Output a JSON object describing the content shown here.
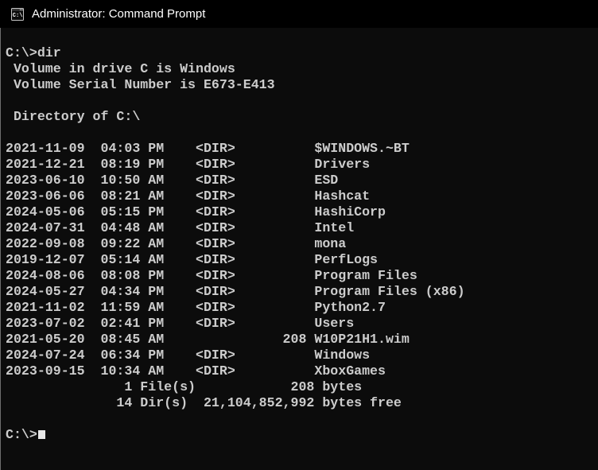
{
  "window": {
    "title": "Administrator: Command Prompt"
  },
  "colors": {
    "titlebar_background": "#000000",
    "titlebar_text": "#FFFFFF",
    "console_background": "#0C0C0C",
    "console_text": "#CCCCCC",
    "cursor": "#E8E8E8",
    "window_border": "#6E6E6E"
  },
  "terminal": {
    "lines": [
      "C:\\>dir",
      " Volume in drive C is Windows",
      " Volume Serial Number is E673-E413",
      "",
      " Directory of C:\\",
      "",
      "2021-11-09  04:03 PM    <DIR>          $WINDOWS.~BT",
      "2021-12-21  08:19 PM    <DIR>          Drivers",
      "2023-06-10  10:50 AM    <DIR>          ESD",
      "2023-06-06  08:21 AM    <DIR>          Hashcat",
      "2024-05-06  05:15 PM    <DIR>          HashiCorp",
      "2024-07-31  04:48 AM    <DIR>          Intel",
      "2022-09-08  09:22 AM    <DIR>          mona",
      "2019-12-07  05:14 AM    <DIR>          PerfLogs",
      "2024-08-06  08:08 PM    <DIR>          Program Files",
      "2024-05-27  04:34 PM    <DIR>          Program Files (x86)",
      "2021-11-02  11:59 AM    <DIR>          Python2.7",
      "2023-07-02  02:41 PM    <DIR>          Users",
      "2021-05-20  08:45 AM               208 W10P21H1.wim",
      "2024-07-24  06:34 PM    <DIR>          Windows",
      "2023-09-15  10:34 AM    <DIR>          XboxGames",
      "               1 File(s)            208 bytes",
      "              14 Dir(s)  21,104,852,992 bytes free",
      ""
    ],
    "prompt": "C:\\>",
    "command": "dir",
    "volume_label": "Windows",
    "volume_serial": "E673-E413",
    "file_count": "1",
    "dir_count": "14",
    "bytes_used": "208",
    "bytes_free": "21,104,852,992"
  }
}
